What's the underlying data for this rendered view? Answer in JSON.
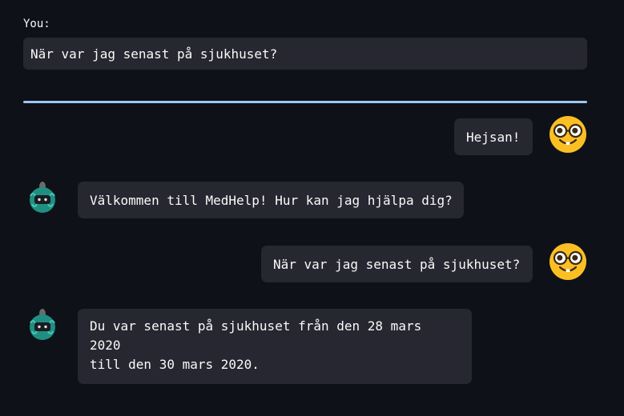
{
  "input": {
    "label": "You:",
    "value": "När var jag senast på sjukhuset?"
  },
  "messages": [
    {
      "role": "user",
      "text": "Hejsan!",
      "avatar": "nerd-face-icon"
    },
    {
      "role": "bot",
      "text": "Välkommen till MedHelp! Hur kan jag hjälpa dig?",
      "avatar": "robot-icon"
    },
    {
      "role": "user",
      "text": "När var jag senast på sjukhuset?",
      "avatar": "nerd-face-icon"
    },
    {
      "role": "bot",
      "text_line1": "Du var senast på sjukhuset från den 28 mars 2020",
      "text_line2": "till den 30 mars 2020.",
      "avatar": "robot-icon"
    }
  ],
  "colors": {
    "background": "#0e1117",
    "bubble": "#262730",
    "divider": "#9cc8f2",
    "emoji_face": "#fbbf24",
    "robot_body": "#1f8f83"
  }
}
